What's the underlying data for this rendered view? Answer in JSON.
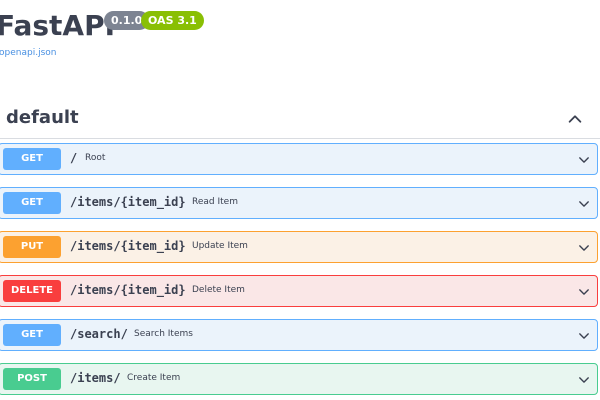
{
  "info": {
    "title": "FastAPI",
    "version": "0.1.0",
    "oas": "OAS 3.1",
    "spec_link": "/openapi.json"
  },
  "tag": {
    "name": "default",
    "expanded": true
  },
  "operations": [
    {
      "method": "GET",
      "path": "/",
      "summary": "Root"
    },
    {
      "method": "GET",
      "path": "/items/{item_id}",
      "summary": "Read Item"
    },
    {
      "method": "PUT",
      "path": "/items/{item_id}",
      "summary": "Update Item"
    },
    {
      "method": "DELETE",
      "path": "/items/{item_id}",
      "summary": "Delete Item"
    },
    {
      "method": "GET",
      "path": "/search/",
      "summary": "Search Items"
    },
    {
      "method": "POST",
      "path": "/items/",
      "summary": "Create Item"
    }
  ],
  "icons": {
    "tag_toggle": "chevron-up-icon",
    "operation_toggle": "chevron-down-icon"
  },
  "colors": {
    "get": "#61affe",
    "put": "#fca130",
    "delete": "#f93e3e",
    "post": "#49cc90",
    "text": "#3b4151",
    "link": "#4990e2",
    "version_badge": "#7d8492",
    "oas_badge": "#89bf04"
  }
}
